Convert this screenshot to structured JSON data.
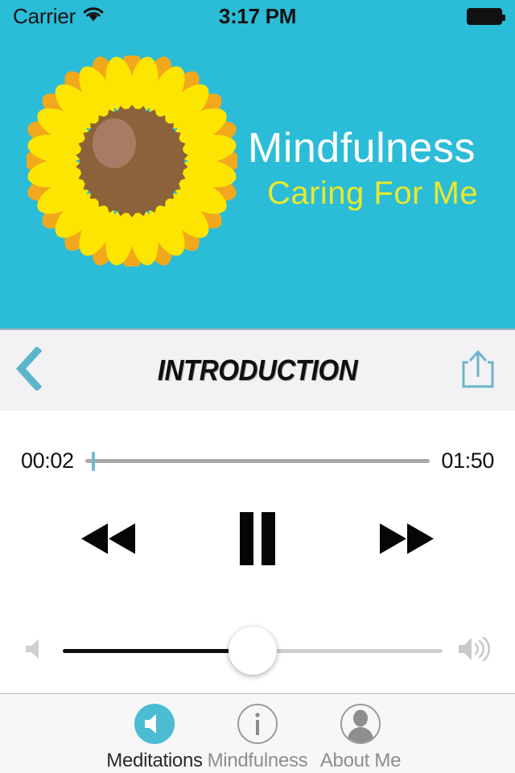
{
  "status_bar": {
    "carrier": "Carrier",
    "wifi_icon": "wifi-icon",
    "time": "3:17 PM",
    "battery_icon": "battery-full-icon"
  },
  "hero": {
    "background_color": "#2BBCD8",
    "logo_icon": "sunflower-icon",
    "title": "Mindfulness",
    "subtitle": "Caring For Me",
    "title_color": "#FFFFFF",
    "subtitle_color": "#E9E92B"
  },
  "nav_bar": {
    "back_icon": "chevron-left-icon",
    "title": "INTRODUCTION",
    "share_icon": "share-icon",
    "accent_color": "#5BB5CC",
    "background_color": "#F2F2F4"
  },
  "player": {
    "current_time": "00:02",
    "total_time": "01:50",
    "progress_percent": 2,
    "rewind_icon": "rewind-icon",
    "playpause_icon": "pause-icon",
    "forward_icon": "fast-forward-icon",
    "volume_percent": 50,
    "volume_low_icon": "volume-low-icon",
    "volume_high_icon": "volume-high-icon"
  },
  "tab_bar": {
    "items": [
      {
        "label": "Meditations",
        "icon": "speaker-circle-icon",
        "active": true
      },
      {
        "label": "Mindfulness",
        "icon": "info-circle-icon",
        "active": false
      },
      {
        "label": "About Me",
        "icon": "person-circle-icon",
        "active": false
      }
    ],
    "active_color": "#4BBCD2"
  }
}
